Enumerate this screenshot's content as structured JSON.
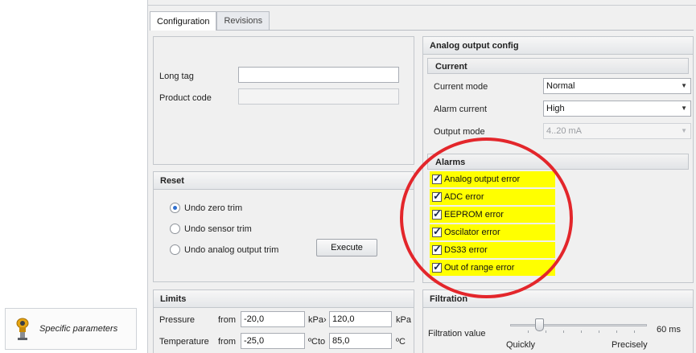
{
  "nav": {
    "specific_parameters": "Specific parameters",
    "icon": "transmitter-icon"
  },
  "tabs": [
    {
      "label": "Configuration",
      "active": true
    },
    {
      "label": "Revisions",
      "active": false
    }
  ],
  "identity": {
    "long_tag_label": "Long tag",
    "long_tag_value": "",
    "product_code_label": "Product code",
    "product_code_value": ""
  },
  "reset": {
    "title": "Reset",
    "options": [
      {
        "label": "Undo zero trim",
        "selected": true
      },
      {
        "label": "Undo sensor trim",
        "selected": false
      },
      {
        "label": "Undo analog output trim",
        "selected": false
      }
    ],
    "execute_label": "Execute"
  },
  "limits": {
    "title": "Limits",
    "rows": [
      {
        "label": "Pressure",
        "from_label": "from",
        "from_value": "-20,0",
        "unit_from": "kPa›",
        "to_value": "120,0",
        "unit_to": "kPa"
      },
      {
        "label": "Temperature",
        "from_label": "from",
        "from_value": "-25,0",
        "unit_from": "ºCto",
        "to_value": "85,0",
        "unit_to": "ºC"
      }
    ]
  },
  "analog_output": {
    "title": "Analog output config",
    "current": {
      "title": "Current",
      "current_mode_label": "Current mode",
      "current_mode_value": "Normal",
      "alarm_current_label": "Alarm current",
      "alarm_current_value": "High",
      "output_mode_label": "Output mode",
      "output_mode_value": "4..20 mA"
    },
    "alarms": {
      "title": "Alarms",
      "items": [
        {
          "label": "Analog output error",
          "checked": true
        },
        {
          "label": "ADC error",
          "checked": true
        },
        {
          "label": "EEPROM error",
          "checked": true
        },
        {
          "label": "Oscilator error",
          "checked": true
        },
        {
          "label": "DS33 error",
          "checked": true
        },
        {
          "label": "Out of range error",
          "checked": true
        }
      ]
    }
  },
  "filtration": {
    "title": "Filtration",
    "value_label": "Filtration value",
    "value": "60 ms",
    "left_label": "Quickly",
    "right_label": "Precisely",
    "slider_fraction": 0.22
  },
  "colors": {
    "highlight": "#ffff00",
    "annotation": "#e3262b",
    "radio_selected": "#2f6fcf"
  }
}
